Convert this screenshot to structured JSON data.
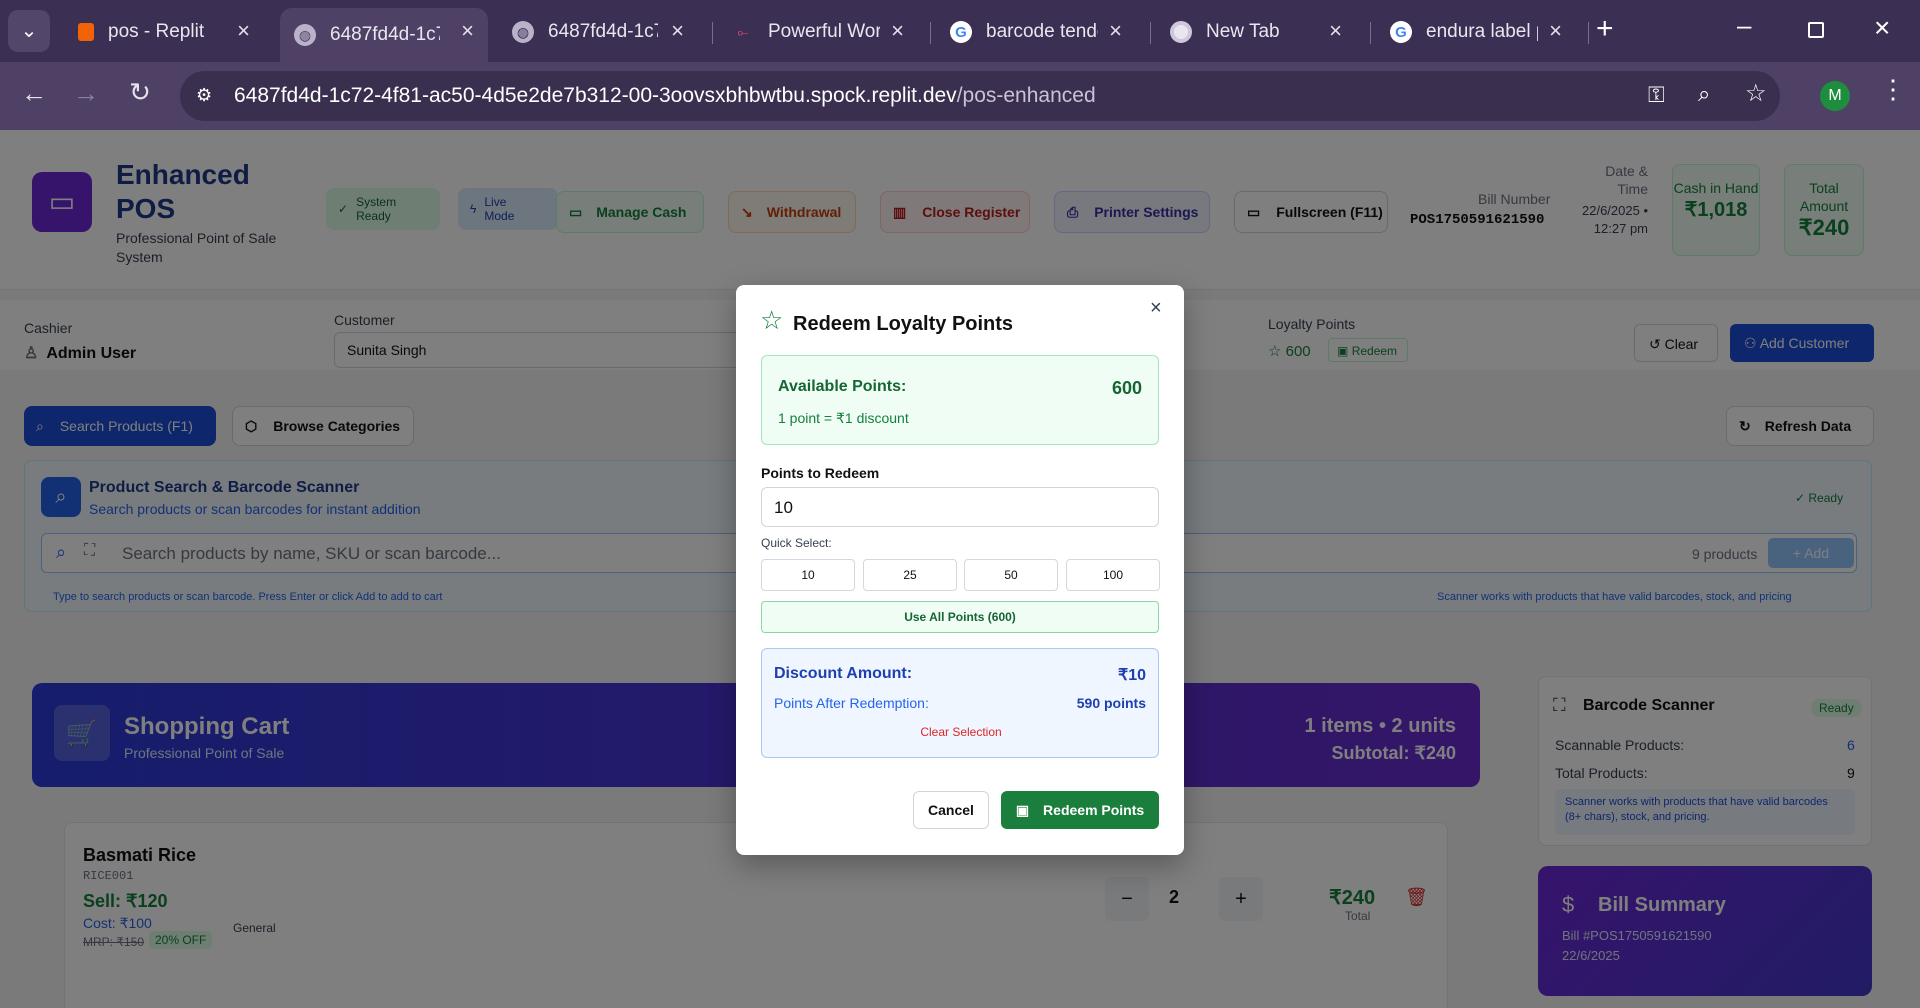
{
  "browser": {
    "tabs": [
      {
        "label": "pos - Replit",
        "icon": "replit-icon"
      },
      {
        "label": "6487fd4d-1c7...",
        "icon": "globe-icon"
      },
      {
        "label": "6487fd4d-1c7...",
        "icon": "globe-icon"
      },
      {
        "label": "Powerful Work...",
        "icon": "workflow-icon"
      },
      {
        "label": "barcode tende...",
        "icon": "google-icon"
      },
      {
        "label": "New Tab",
        "icon": "chrome-icon"
      },
      {
        "label": "endura label p...",
        "icon": "google-icon"
      }
    ],
    "url_host": "6487fd4d-1c72-4f81-ac50-4d5e2de7b312-00-3oovsxbhbwtbu.spock.replit.dev",
    "url_path": "/pos-enhanced",
    "profile_initial": "M"
  },
  "header": {
    "title": "Enhanced POS",
    "subtitle": "Professional Point of Sale System",
    "status_system": "System Ready",
    "status_live": "Live Mode",
    "manage_cash": "Manage Cash",
    "withdrawal": "Withdrawal",
    "close_register": "Close Register",
    "printer_settings": "Printer Settings",
    "fullscreen": "Fullscreen (F11)",
    "bill_number_label": "Bill Number",
    "bill_number": "POS1750591621590",
    "date_label": "Date & Time",
    "date_value": "22/6/2025 • 12:27 pm",
    "cash_label": "Cash in Hand",
    "cash_value": "₹1,018",
    "total_label": "Total Amount",
    "total_value": "₹240"
  },
  "customer_bar": {
    "cashier_label": "Cashier",
    "cashier_name": "Admin User",
    "customer_label": "Customer",
    "customer_name": "Sunita Singh",
    "loyalty_label": "Loyalty Points",
    "loyalty_points": "600",
    "redeem": "Redeem",
    "clear": "Clear",
    "add_customer": "Add Customer"
  },
  "search_tabs": {
    "search_products": "Search Products (F1)",
    "browse_categories": "Browse Categories",
    "refresh": "Refresh Data"
  },
  "product_search": {
    "title": "Product Search & Barcode Scanner",
    "subtitle": "Search products or scan barcodes for instant addition",
    "status": "Ready",
    "placeholder": "Search products by name, SKU or scan barcode...",
    "count": "9 products",
    "add": "Add",
    "hint_left": "Type to search products or scan barcode. Press Enter or click Add to add to cart",
    "hint_right": "Scanner works with products that have valid barcodes, stock, and pricing"
  },
  "cart": {
    "title": "Shopping Cart",
    "subtitle": "Professional Point of Sale",
    "summary": "1 items • 2 units",
    "subtotal": "Subtotal: ₹240",
    "item": {
      "name": "Basmati Rice",
      "sku": "RICE001",
      "sell": "Sell: ₹120",
      "cost": "Cost: ₹100",
      "mrp": "MRP: ₹150",
      "discount": "20% OFF",
      "category": "General",
      "qty": "2",
      "total": "₹240",
      "total_label": "Total"
    }
  },
  "scanner_panel": {
    "title": "Barcode Scanner",
    "status": "Ready",
    "scannable_label": "Scannable Products:",
    "scannable_value": "6",
    "total_label": "Total Products:",
    "total_value": "9",
    "note": "Scanner works with products that have valid barcodes (8+ chars), stock, and pricing."
  },
  "bill_summary": {
    "title": "Bill Summary",
    "bill_no": "Bill #POS1750591621590",
    "date": "22/6/2025"
  },
  "modal": {
    "title": "Redeem Loyalty Points",
    "available_label": "Available Points:",
    "available_value": "600",
    "rate": "1 point = ₹1 discount",
    "points_label": "Points to Redeem",
    "points_value": "10",
    "quick_select_label": "Quick Select:",
    "quick_options": [
      "10",
      "25",
      "50",
      "100"
    ],
    "use_all": "Use All Points (600)",
    "discount_label": "Discount Amount:",
    "discount_value": "₹10",
    "after_label": "Points After Redemption:",
    "after_value": "590 points",
    "clear_selection": "Clear Selection",
    "cancel": "Cancel",
    "redeem": "Redeem Points"
  },
  "colors": {
    "chrome_tabstrip": "#3b2f53",
    "chrome_toolbar": "#4e4165",
    "primary_green": "#1a7f3c",
    "primary_blue": "#2563eb",
    "danger": "#dc2626",
    "cart_banner": "#3b2bbf"
  }
}
